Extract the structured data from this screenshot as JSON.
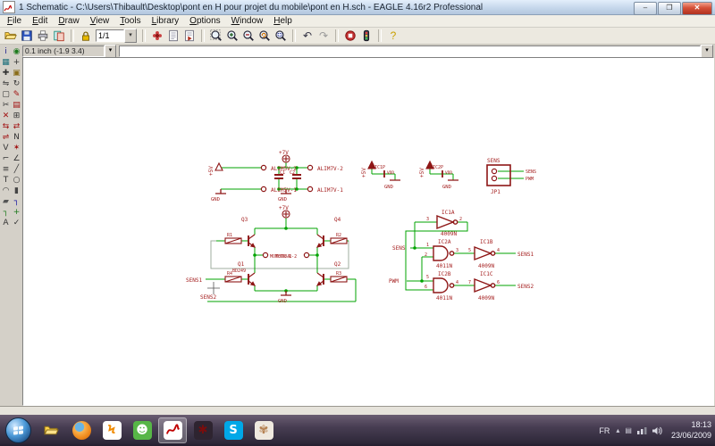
{
  "window": {
    "title": "1 Schematic - C:\\Users\\Thibault\\Desktop\\pont en H pour projet du mobile\\pont en H.sch - EAGLE 4.16r2 Professional",
    "controls": {
      "minimize": "–",
      "maximize": "❐",
      "close": "✕"
    }
  },
  "menu": {
    "items": [
      "File",
      "Edit",
      "Draw",
      "View",
      "Tools",
      "Library",
      "Options",
      "Window",
      "Help"
    ]
  },
  "toolbar": {
    "sheet": "1/1",
    "sheet_dd": "▾",
    "items": [
      {
        "kind": "sym",
        "name": "open-icon",
        "sym": "open"
      },
      {
        "kind": "sym",
        "name": "save-icon",
        "sym": "save"
      },
      {
        "kind": "sym",
        "name": "print-icon",
        "sym": "print"
      },
      {
        "kind": "sym",
        "name": "cam-processor-icon",
        "sym": "cam"
      },
      {
        "kind": "sep"
      },
      {
        "kind": "sym",
        "name": "lock-icon",
        "sym": "lock"
      },
      {
        "kind": "sheet",
        "name": "sheet-selector"
      },
      {
        "kind": "sep"
      },
      {
        "kind": "sym",
        "name": "use-library-icon",
        "sym": "use"
      },
      {
        "kind": "sym",
        "name": "script-icon",
        "sym": "script"
      },
      {
        "kind": "sym",
        "name": "run-icon",
        "sym": "run"
      },
      {
        "kind": "sep"
      },
      {
        "kind": "sym",
        "name": "zoom-fit-icon",
        "sym": "zoomfit"
      },
      {
        "kind": "sym",
        "name": "zoom-in-icon",
        "sym": "zoomin"
      },
      {
        "kind": "sym",
        "name": "zoom-out-icon",
        "sym": "zoomout"
      },
      {
        "kind": "sym",
        "name": "zoom-redraw-icon",
        "sym": "zoomredraw"
      },
      {
        "kind": "sym",
        "name": "zoom-select-icon",
        "sym": "zoomselect"
      },
      {
        "kind": "sep"
      },
      {
        "kind": "glyph",
        "name": "undo-icon",
        "glyph": "↶",
        "color": "#333344"
      },
      {
        "kind": "glyph",
        "name": "redo-icon",
        "glyph": "↷",
        "color": "#9a9a9a"
      },
      {
        "kind": "sep"
      },
      {
        "kind": "sym",
        "name": "stop-icon",
        "sym": "stop"
      },
      {
        "kind": "sym",
        "name": "traffic-light-icon",
        "sym": "traffic"
      },
      {
        "kind": "sep"
      },
      {
        "kind": "glyph",
        "name": "help-icon",
        "glyph": "?",
        "color": "#c9a000"
      }
    ]
  },
  "command_bar": {
    "coords": "0.1 inch (-1.9 3.4)",
    "dd": "▾",
    "command_value": ""
  },
  "palette": {
    "tools": [
      {
        "name": "info",
        "glyph": "i",
        "color": "#1a1a8c"
      },
      {
        "name": "show",
        "glyph": "◉",
        "color": "#1c7a1c"
      },
      {
        "name": "display",
        "glyph": "▦",
        "color": "#1b6e7a"
      },
      {
        "name": "mark",
        "glyph": "+",
        "color": "#333333"
      },
      {
        "name": "move",
        "glyph": "✚",
        "color": "#333333"
      },
      {
        "name": "copy",
        "glyph": "▣",
        "color": "#8a6d1a"
      },
      {
        "name": "mirror",
        "glyph": "⇋",
        "color": "#333333"
      },
      {
        "name": "rotate",
        "glyph": "↻",
        "color": "#333333"
      },
      {
        "name": "group",
        "glyph": "▢",
        "color": "#333333"
      },
      {
        "name": "change",
        "glyph": "✎",
        "color": "#a01010"
      },
      {
        "name": "cut",
        "glyph": "✂",
        "color": "#333333"
      },
      {
        "name": "paste",
        "glyph": "▤",
        "color": "#a01010"
      },
      {
        "name": "delete",
        "glyph": "✕",
        "color": "#a01010"
      },
      {
        "name": "add",
        "glyph": "⊞",
        "color": "#333333"
      },
      {
        "name": "pinswap",
        "glyph": "⇆",
        "color": "#a01010"
      },
      {
        "name": "gateswap",
        "glyph": "⇄",
        "color": "#a01010"
      },
      {
        "name": "replace",
        "glyph": "⇌",
        "color": "#a01010"
      },
      {
        "name": "name",
        "glyph": "N",
        "color": "#333333"
      },
      {
        "name": "value",
        "glyph": "V",
        "color": "#333333"
      },
      {
        "name": "smash",
        "glyph": "✶",
        "color": "#a01010"
      },
      {
        "name": "miter",
        "glyph": "⌐",
        "color": "#333333"
      },
      {
        "name": "split",
        "glyph": "∠",
        "color": "#333333"
      },
      {
        "name": "invoke",
        "glyph": "≡",
        "color": "#333333"
      },
      {
        "name": "wire",
        "glyph": "╱",
        "color": "#333333"
      },
      {
        "name": "text",
        "glyph": "T",
        "color": "#333333"
      },
      {
        "name": "circle",
        "glyph": "○",
        "color": "#333333"
      },
      {
        "name": "arc",
        "glyph": "◠",
        "color": "#333333"
      },
      {
        "name": "rect",
        "glyph": "▮",
        "color": "#444444"
      },
      {
        "name": "polygon",
        "glyph": "▰",
        "color": "#555555"
      },
      {
        "name": "bus",
        "glyph": "┐",
        "color": "#1010a0"
      },
      {
        "name": "net",
        "glyph": "┐",
        "color": "#1c7a1c"
      },
      {
        "name": "junction",
        "glyph": "+",
        "color": "#1c7a1c"
      },
      {
        "name": "label",
        "glyph": "A",
        "color": "#333333"
      },
      {
        "name": "erc",
        "glyph": "✓",
        "color": "#333333"
      }
    ]
  },
  "schematic": {
    "colors": {
      "net": "#00a300",
      "symbol": "#8e1616",
      "text": "#a52020",
      "airwire": "#9fae9f"
    },
    "labels": {
      "p5v": "+5V",
      "p7v": "+7V",
      "gnd": "GND",
      "c1": "C1",
      "c2": "C2",
      "alim5v2": "ALIM5V-2",
      "alim5v1": "ALIM5V-1",
      "alim7v2": "ALIM7V-2",
      "alim7v1": "ALIM7V-1",
      "ic1p": "IC1P",
      "ic2p": "IC2P",
      "vdd": "VDD",
      "sens": "SENS",
      "pwm": "PWM",
      "jp1": "JP1",
      "q1": "Q1",
      "q2": "Q2",
      "q3": "Q3",
      "q4": "Q4",
      "bd249": "BD249",
      "r1": "R1",
      "r2": "R2",
      "r3": "R3",
      "r4": "R4",
      "moteur1": "MOTEUR-1",
      "moteur2": "MOTEUR-2",
      "sens1": "SENS1",
      "sens2": "SENS2",
      "ic1a": "IC1A",
      "ic1b": "IC1B",
      "ic1c": "IC1C",
      "ic2a": "IC2A",
      "ic2b": "IC2B",
      "v4009": "4009N",
      "v4011": "4011N"
    },
    "pins": {
      "p1": "1",
      "p2": "2",
      "p3": "3",
      "p4": "4",
      "p5": "5",
      "p6": "6",
      "p7": "7"
    }
  },
  "taskbar": {
    "language": "FR",
    "time": "18:13",
    "date": "23/06/2009",
    "apps": [
      {
        "name": "start-button",
        "kind": "orb"
      },
      {
        "name": "explorer-app",
        "kind": "sym",
        "sym": "open",
        "bg": "#ffffff00"
      },
      {
        "name": "firefox-app",
        "kind": "firefox"
      },
      {
        "name": "winamp-app",
        "kind": "glyph",
        "glyph": "Ϟ",
        "fg": "#f08a00",
        "bg": "#ffffff"
      },
      {
        "name": "messenger-app",
        "kind": "glyph",
        "glyph": "☻",
        "fg": "#ffffff",
        "bg": "#57b647"
      },
      {
        "name": "eagle-app",
        "kind": "sym",
        "sym": "eagle",
        "bg": "#ffffff",
        "active": true
      },
      {
        "name": "eagle-control-panel-app",
        "kind": "glyph",
        "glyph": "✱",
        "fg": "#7a0d0d",
        "bg": "#2e2430"
      },
      {
        "name": "skype-app",
        "kind": "glyph",
        "glyph": "S",
        "fg": "#ffffff",
        "bg": "#00a8e8"
      },
      {
        "name": "gimp-app",
        "kind": "glyph",
        "glyph": "✾",
        "fg": "#b58050",
        "bg": "#efe9df"
      }
    ],
    "tray_icons": [
      {
        "name": "show-hidden-icons",
        "glyph": "▴"
      },
      {
        "name": "display-tray-icon",
        "glyph": "▤"
      },
      {
        "name": "network-icon",
        "glyph": ""
      },
      {
        "name": "volume-icon",
        "glyph": ""
      }
    ]
  }
}
